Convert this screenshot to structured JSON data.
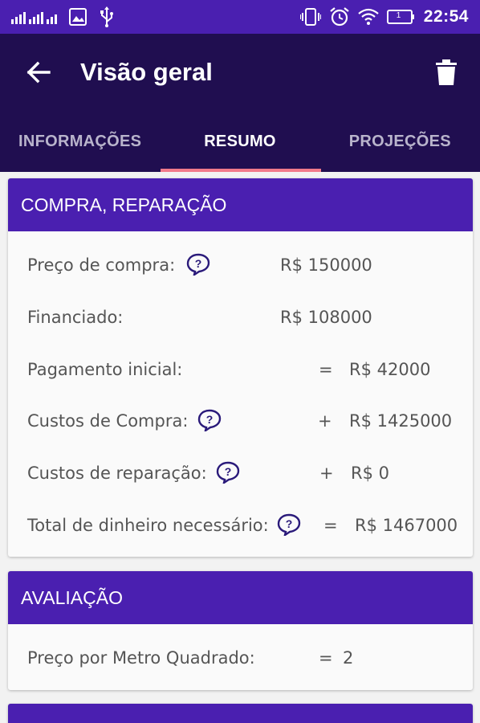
{
  "status_bar": {
    "time": "22:54",
    "battery_label": "1",
    "icons": [
      "signal-icon",
      "image-icon",
      "usb-icon",
      "vibrate-icon",
      "alarm-icon",
      "wifi-icon",
      "battery-icon"
    ]
  },
  "toolbar": {
    "title": "Visão geral",
    "back_icon": "arrow-left-icon",
    "delete_icon": "trash-icon"
  },
  "tabs": [
    {
      "label": "INFORMAÇÕES",
      "active": false
    },
    {
      "label": "RESUMO",
      "active": true
    },
    {
      "label": "PROJEÇÕES",
      "active": false
    }
  ],
  "colors": {
    "status_bar": "#4a1fb0",
    "app_bar": "#200e50",
    "card_header": "#4a1fb0",
    "tab_indicator": "#f07a8a",
    "help_icon": "#2a1a7a"
  },
  "compra": {
    "header": "COMPRA, REPARAÇÃO",
    "rows": [
      {
        "label": "Preço de compra:",
        "op": "",
        "value": "R$ 150000"
      },
      {
        "label": "Financiado:",
        "op": "",
        "value": "R$ 108000"
      },
      {
        "label": "Pagamento inicial:",
        "op": "=",
        "value": "R$ 42000"
      },
      {
        "label": "Custos de Compra:",
        "op": "+",
        "value": "R$ 1425000"
      },
      {
        "label": "Custos de reparação:",
        "op": "+",
        "value": "R$ 0"
      },
      {
        "label": "Total de dinheiro necessário:",
        "op": "=",
        "value": "R$ 1467000"
      }
    ]
  },
  "avaliacao": {
    "header": "AVALIAÇÃO",
    "rows": [
      {
        "label": "Preço por Metro Quadrado:",
        "op": "=",
        "value": "2"
      }
    ]
  }
}
